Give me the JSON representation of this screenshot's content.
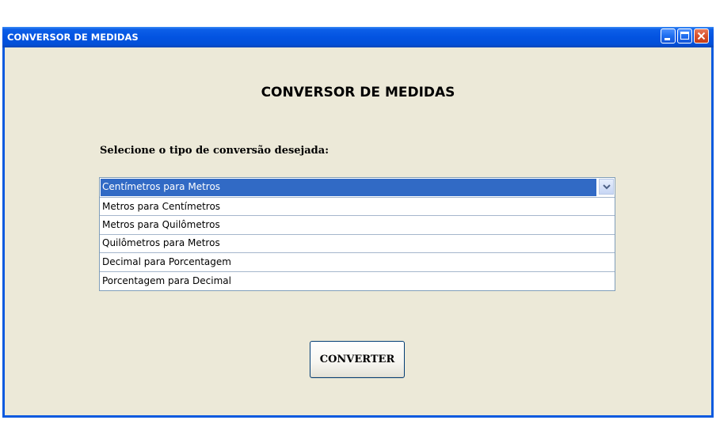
{
  "window": {
    "title": "CONVERSOR DE MEDIDAS",
    "controls": {
      "minimize_icon": "minimize-icon",
      "maximize_icon": "maximize-icon",
      "close_icon": "close-icon"
    },
    "accent_color": "#0a5adf",
    "background_color": "#ece9d8"
  },
  "main": {
    "heading": "CONVERSOR DE MEDIDAS",
    "prompt": "Selecione o tipo de conversão desejada:",
    "conversion_list": {
      "selected": "Centímetros para Metros",
      "selected_color": "#316ac5",
      "options": [
        "Centímetros para Metros",
        "Metros para Centímetros",
        "Metros para Quilômetros",
        "Quilômetros para Metros",
        "Decimal para Porcentagem",
        "Porcentagem para Decimal"
      ],
      "dropdown_icon": "chevron-down-icon"
    },
    "convert_button_label": "CONVERTER"
  }
}
